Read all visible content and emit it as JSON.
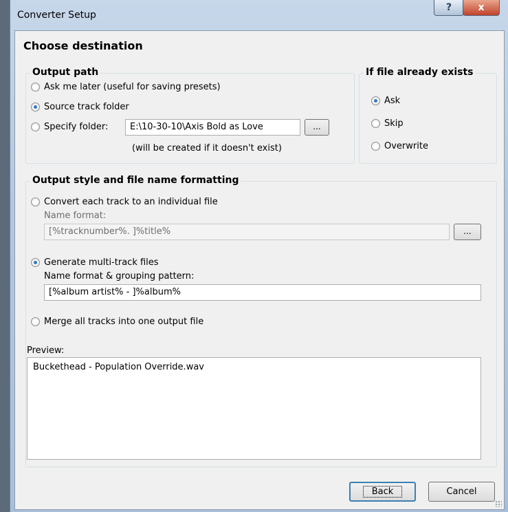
{
  "window": {
    "title": "Converter Setup",
    "help_label": "?",
    "close_label": "x"
  },
  "heading": "Choose destination",
  "output_path": {
    "legend": "Output path",
    "options": [
      {
        "label": "Ask me later (useful for saving presets)",
        "checked": false
      },
      {
        "label": "Source track folder",
        "checked": true
      },
      {
        "label": "Specify folder:",
        "checked": false
      }
    ],
    "folder_value": "E:\\10-30-10\\Axis Bold as Love",
    "browse_label": "...",
    "note": "(will be created if it doesn't exist)"
  },
  "if_exists": {
    "legend": "If file already exists",
    "options": [
      {
        "label": "Ask",
        "checked": true
      },
      {
        "label": "Skip",
        "checked": false
      },
      {
        "label": "Overwrite",
        "checked": false
      }
    ]
  },
  "output_style": {
    "legend": "Output style and file name formatting",
    "individual": {
      "label": "Convert each track to an individual file",
      "checked": false
    },
    "name_format_label": "Name format:",
    "name_format_value": "[%tracknumber%. ]%title%",
    "browse_label": "...",
    "multitrack": {
      "label": "Generate multi-track files",
      "checked": true
    },
    "grouping_label": "Name format & grouping pattern:",
    "grouping_value": "[%album artist% - ]%album%",
    "merge": {
      "label": "Merge all tracks into one output file",
      "checked": false
    }
  },
  "preview": {
    "label": "Preview:",
    "value": "Buckethead - Population Override.wav"
  },
  "buttons": {
    "back": "Back",
    "cancel": "Cancel"
  }
}
